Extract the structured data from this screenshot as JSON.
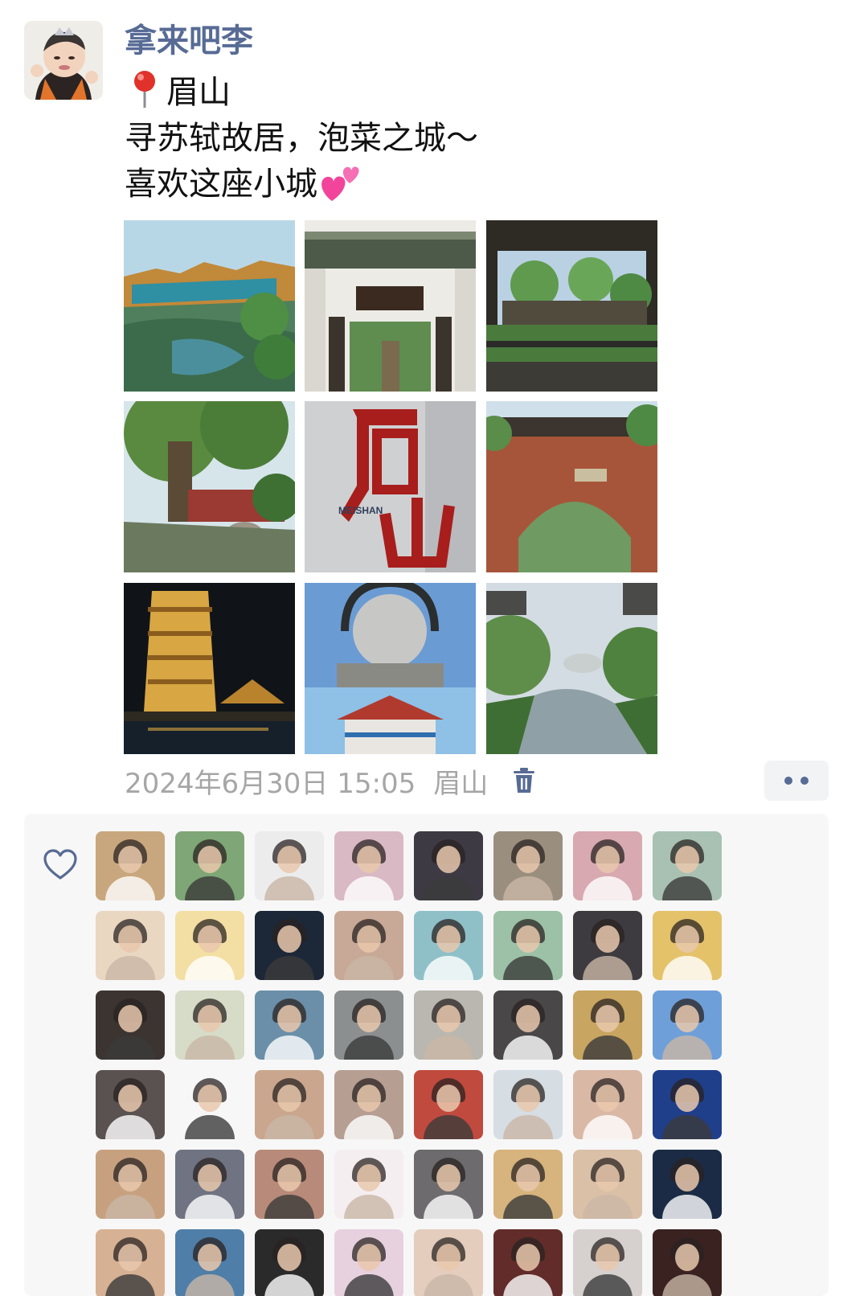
{
  "post": {
    "author": "拿来吧李",
    "location_line": "眉山",
    "line2": "寻苏轼故居，泡菜之城～",
    "line3": "喜欢这座小城",
    "timestamp": "2024年6月30日 15:05",
    "location": "眉山"
  },
  "icons": {
    "avatar": "avatar",
    "pin": "round-pushpin-icon",
    "hearts": "two-hearts-icon",
    "trash": "trash-icon",
    "more": "more-dots-icon",
    "like": "heart-outline-icon"
  },
  "colors": {
    "username": "#576b95",
    "meta": "#a6a6a6",
    "like_panel": "#f7f7f7"
  },
  "likers": {
    "count": 48,
    "backgrounds": [
      "#c9a77e",
      "#7fa676",
      "#ececec",
      "#d9b9c4",
      "#3d3a44",
      "#9a8e7e",
      "#d8a9b0",
      "#a9c1b2",
      "#e9d7c2",
      "#f3dfa3",
      "#1c2737",
      "#c8a896",
      "#8fc0c8",
      "#9cc1a7",
      "#3d3b3f",
      "#e3c26a",
      "#3b3431",
      "#d6dcc8",
      "#6b8fa8",
      "#8c8f8f",
      "#b9b7b0",
      "#4a4748",
      "#c8a560",
      "#6f9fd8",
      "#5a5250",
      "#f7f7f7",
      "#c9a68d",
      "#b69e92",
      "#c04a3e",
      "#d6dde3",
      "#d9b8a6",
      "#1f3f8a",
      "#c7a17f",
      "#6f7382",
      "#b88a7a",
      "#f5eef0",
      "#6d6b6d",
      "#d7b37d",
      "#d9c0a7",
      "#1b2b45",
      "#d7b194",
      "#4f7ea8",
      "#2a2a2a",
      "#e7d1df",
      "#e4cdbd",
      "#612c29",
      "#d6d1cf",
      "#3a2220"
    ]
  }
}
